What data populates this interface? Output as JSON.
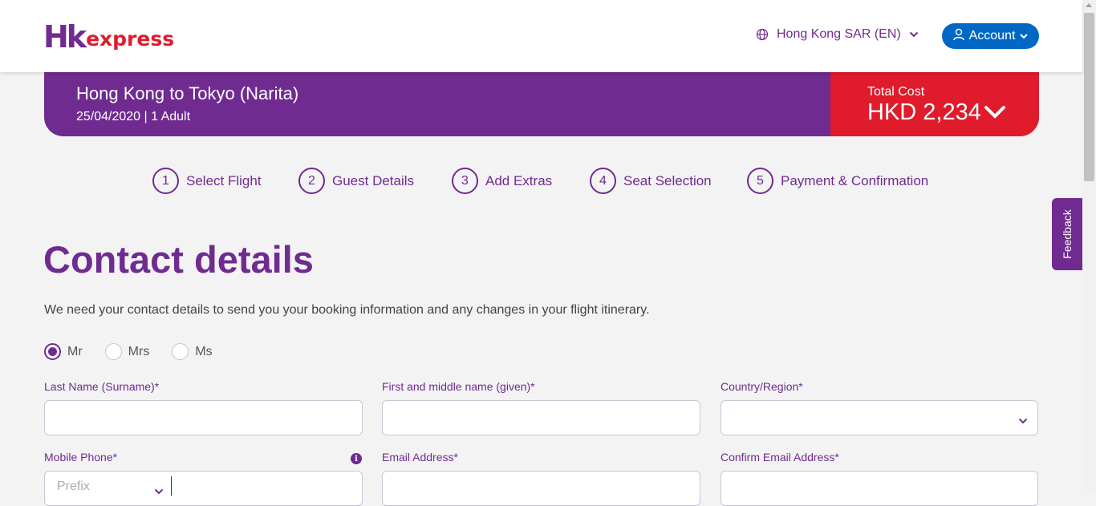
{
  "header": {
    "logo_hk": "Hk",
    "logo_express": "express",
    "locale": "Hong Kong SAR (EN)",
    "account": "Account"
  },
  "booking": {
    "route": "Hong Kong to Tokyo (Narita)",
    "date_pax": "25/04/2020 | 1 Adult",
    "total_label": "Total Cost",
    "total_value": "HKD 2,234"
  },
  "steps": [
    {
      "num": "1",
      "label": "Select Flight"
    },
    {
      "num": "2",
      "label": "Guest Details"
    },
    {
      "num": "3",
      "label": "Add Extras"
    },
    {
      "num": "4",
      "label": "Seat Selection"
    },
    {
      "num": "5",
      "label": "Payment & Confirmation"
    }
  ],
  "feedback": "Feedback",
  "contact": {
    "title": "Contact details",
    "description": "We need your contact details to send you your booking information and any changes in your flight itinerary.",
    "titles": [
      {
        "label": "Mr",
        "checked": true
      },
      {
        "label": "Mrs",
        "checked": false
      },
      {
        "label": "Ms",
        "checked": false
      }
    ],
    "fields": {
      "last_name": {
        "label": "Last Name (Surname)*",
        "value": ""
      },
      "first_name": {
        "label": "First and middle name (given)*",
        "value": ""
      },
      "country": {
        "label": "Country/Region*",
        "value": ""
      },
      "mobile": {
        "label": "Mobile Phone*",
        "prefix_placeholder": "Prefix",
        "value": ""
      },
      "email": {
        "label": "Email Address*",
        "value": ""
      },
      "confirm_email": {
        "label": "Confirm Email Address*",
        "value": ""
      }
    }
  },
  "colors": {
    "brand_purple": "#702b91",
    "brand_red": "#e01b2b",
    "account_blue": "#0067c5"
  }
}
